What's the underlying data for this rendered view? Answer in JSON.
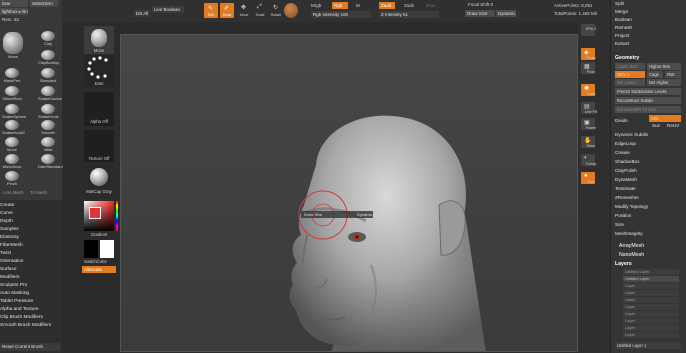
{
  "left_top": {
    "row1_a": "lone",
    "row1_b": "SelectSrm",
    "row2_a": "lightbox ▸ Brushes",
    "row3_a": "Rem",
    "row3_b": "82"
  },
  "brushes": [
    {
      "label": "Move"
    },
    {
      "label": "Clay"
    },
    {
      "label": "ClayBuildup"
    },
    {
      "label": "MaskPen"
    },
    {
      "label": "Standard"
    },
    {
      "label": "SelectRect"
    },
    {
      "label": "SnakeCactus"
    },
    {
      "label": "SnakeSphere"
    },
    {
      "label": "SnakeHook"
    },
    {
      "label": "SnakeHook2"
    },
    {
      "label": "Smooth"
    },
    {
      "label": "Move"
    },
    {
      "label": "Inflat"
    },
    {
      "label": "MoveAccu"
    },
    {
      "label": "DamStandard"
    },
    {
      "label": "Pinch"
    }
  ],
  "brush_footer": {
    "a": "Lsm Mesh",
    "b": "To Mesh"
  },
  "left_menu": [
    "Create",
    "Curve",
    "Depth",
    "Samples",
    "Elasticity",
    "FiberMesh",
    "Twist",
    "Orientation",
    "Surface",
    "Modifiers",
    "Sculptris Pro",
    "Auto Masking",
    "Tablet Pressure",
    "Alpha and Texture",
    "Clip Brush Modifiers",
    "Smooth Brush Modifiers"
  ],
  "left_footer": "Reset Current Brush",
  "tool_column": {
    "move": "Move",
    "dots": "Dots",
    "alpha_off": "Alpha Off",
    "texture_off": "Texture Off",
    "matcap": "MatCap Gray",
    "gradient": "Gradient",
    "switch_color": "SwitchColor",
    "alternate": "Alternate"
  },
  "toolbar": {
    "ds_all": "DS All",
    "live_boolean": "Live Boolean",
    "edit": "Edit",
    "draw": "Draw",
    "move": "Move",
    "scale": "Scale",
    "rotate": "Rotate",
    "mrgb": "Mrgb",
    "rgb": "Rgb",
    "m": "M",
    "rgb_intensity": "Rgb Intensity 100",
    "zadd": "Zadd",
    "zsub": "Zsub",
    "zcut": "Zcut",
    "z_intensity": "Z Intensity 51",
    "focal_shift": "Focal Shift 0",
    "draw_size": "Draw Size",
    "dynamic": "Dynamic",
    "active_points": "ActivePoints: 8,091",
    "total_points": "TotalPoints: 1.465 Mil"
  },
  "brush_cursor": {
    "size_label": "Draw Size",
    "dynamic": "Dynamic"
  },
  "right_shelf": [
    {
      "label": "SPix 3"
    },
    {
      "label": "Persp"
    },
    {
      "label": "Floor"
    },
    {
      "label": "Local"
    },
    {
      "label": "Line Fill"
    },
    {
      "label": "Frame"
    },
    {
      "label": "Move"
    },
    {
      "label": "Transp"
    },
    {
      "label": "Solo"
    }
  ],
  "right_panel": {
    "top_items": [
      "Split",
      "Merge",
      "Boolean",
      "Remesh",
      "Project",
      "Extract"
    ],
    "geometry": "Geometry",
    "lower_res": "Lower Res",
    "higher_res": "Higher Res",
    "sdiv": "SDiv 1",
    "cage": "Cage",
    "rstr": "Rstr",
    "del_lower": "Del Lower",
    "del_higher": "Del Higher",
    "freeze": "Freeze SubDivision Levels",
    "reconstruct": "Reconstruct Subdiv",
    "convert": "Convert BPR To Geo",
    "divide": "Divide",
    "smt": "Smt",
    "suv": "Suv",
    "rsuv": "ReUV",
    "list": [
      "Dynamic Subdiv",
      "EdgeLoop",
      "Crease",
      "ShadowBox",
      "ClayPolish",
      "DynaMesh",
      "Tessimate",
      "ZRemesher",
      "Modify Topology",
      "Position",
      "Size",
      "MeshIntegrity"
    ],
    "arraymesh": "ArrayMesh",
    "nanomesh": "NanoMesh",
    "layers": "Layers",
    "layer_rows": [
      "Untitled Layer",
      "Untitled Layer",
      "Layer",
      "Layer",
      "Layer",
      "Layer",
      "Layer",
      "Layer",
      "Layer",
      "Layer"
    ],
    "footer_layer": "Untitled Layer 1"
  }
}
